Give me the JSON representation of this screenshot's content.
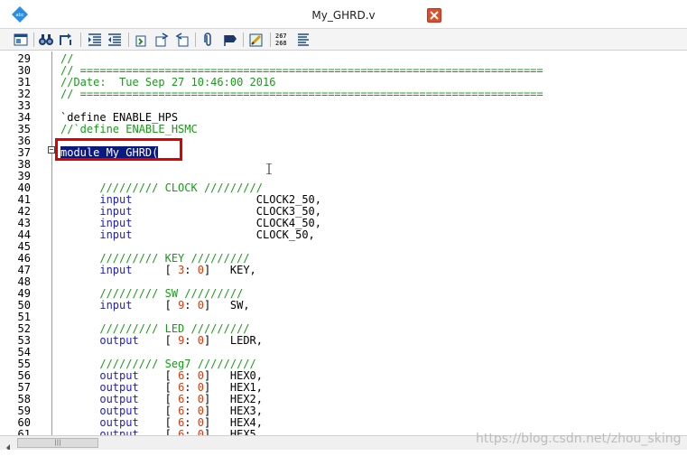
{
  "window": {
    "title": "My_GHRD.v",
    "app_icon_text": "abc"
  },
  "toolbar": {
    "line_count_top": "267",
    "line_count_bottom": "268"
  },
  "code_lines": [
    {
      "n": "29",
      "segments": [
        {
          "t": "//",
          "c": "green"
        }
      ]
    },
    {
      "n": "30",
      "segments": [
        {
          "t": "// =======================================================================",
          "c": "green"
        }
      ]
    },
    {
      "n": "31",
      "segments": [
        {
          "t": "//Date:  Tue Sep 27 10:46:00 2016",
          "c": "green"
        }
      ]
    },
    {
      "n": "32",
      "segments": [
        {
          "t": "// =======================================================================",
          "c": "green"
        }
      ]
    },
    {
      "n": "33",
      "segments": []
    },
    {
      "n": "34",
      "segments": [
        {
          "t": "`define ENABLE_HPS",
          "c": "black"
        }
      ]
    },
    {
      "n": "35",
      "segments": [
        {
          "t": "//`define ENABLE_HSMC",
          "c": "green"
        }
      ]
    },
    {
      "n": "36",
      "segments": []
    },
    {
      "n": "37",
      "segments": [
        {
          "t": "module My_GHRD(",
          "c": "sel"
        }
      ]
    },
    {
      "n": "38",
      "segments": []
    },
    {
      "n": "39",
      "segments": []
    },
    {
      "n": "40",
      "segments": [
        {
          "t": "      ///////// CLOCK /////////",
          "c": "green"
        }
      ]
    },
    {
      "n": "41",
      "segments": [
        {
          "t": "      input",
          "c": "blue"
        },
        {
          "t": "                   CLOCK2_50,",
          "c": "black"
        }
      ]
    },
    {
      "n": "42",
      "segments": [
        {
          "t": "      input",
          "c": "blue"
        },
        {
          "t": "                   CLOCK3_50,",
          "c": "black"
        }
      ]
    },
    {
      "n": "43",
      "segments": [
        {
          "t": "      input",
          "c": "blue"
        },
        {
          "t": "                   CLOCK4_50,",
          "c": "black"
        }
      ]
    },
    {
      "n": "44",
      "segments": [
        {
          "t": "      input",
          "c": "blue"
        },
        {
          "t": "                   CLOCK_50,",
          "c": "black"
        }
      ]
    },
    {
      "n": "45",
      "segments": []
    },
    {
      "n": "46",
      "segments": [
        {
          "t": "      ///////// KEY /////////",
          "c": "green"
        }
      ]
    },
    {
      "n": "47",
      "segments": [
        {
          "t": "      input",
          "c": "blue"
        },
        {
          "t": "     [ ",
          "c": "black"
        },
        {
          "t": "3",
          "c": "red"
        },
        {
          "t": ": ",
          "c": "black"
        },
        {
          "t": "0",
          "c": "red"
        },
        {
          "t": "]   KEY,",
          "c": "black"
        }
      ]
    },
    {
      "n": "48",
      "segments": []
    },
    {
      "n": "49",
      "segments": [
        {
          "t": "      ///////// SW /////////",
          "c": "green"
        }
      ]
    },
    {
      "n": "50",
      "segments": [
        {
          "t": "      input",
          "c": "blue"
        },
        {
          "t": "     [ ",
          "c": "black"
        },
        {
          "t": "9",
          "c": "red"
        },
        {
          "t": ": ",
          "c": "black"
        },
        {
          "t": "0",
          "c": "red"
        },
        {
          "t": "]   SW,",
          "c": "black"
        }
      ]
    },
    {
      "n": "51",
      "segments": []
    },
    {
      "n": "52",
      "segments": [
        {
          "t": "      ///////// LED /////////",
          "c": "green"
        }
      ]
    },
    {
      "n": "53",
      "segments": [
        {
          "t": "      output",
          "c": "blue"
        },
        {
          "t": "    [ ",
          "c": "black"
        },
        {
          "t": "9",
          "c": "red"
        },
        {
          "t": ": ",
          "c": "black"
        },
        {
          "t": "0",
          "c": "red"
        },
        {
          "t": "]   LEDR,",
          "c": "black"
        }
      ]
    },
    {
      "n": "54",
      "segments": []
    },
    {
      "n": "55",
      "segments": [
        {
          "t": "      ///////// Seg7 /////////",
          "c": "green"
        }
      ]
    },
    {
      "n": "56",
      "segments": [
        {
          "t": "      output",
          "c": "blue"
        },
        {
          "t": "    [ ",
          "c": "black"
        },
        {
          "t": "6",
          "c": "red"
        },
        {
          "t": ": ",
          "c": "black"
        },
        {
          "t": "0",
          "c": "red"
        },
        {
          "t": "]   HEX0,",
          "c": "black"
        }
      ]
    },
    {
      "n": "57",
      "segments": [
        {
          "t": "      output",
          "c": "blue"
        },
        {
          "t": "    [ ",
          "c": "black"
        },
        {
          "t": "6",
          "c": "red"
        },
        {
          "t": ": ",
          "c": "black"
        },
        {
          "t": "0",
          "c": "red"
        },
        {
          "t": "]   HEX1,",
          "c": "black"
        }
      ]
    },
    {
      "n": "58",
      "segments": [
        {
          "t": "      output",
          "c": "blue"
        },
        {
          "t": "    [ ",
          "c": "black"
        },
        {
          "t": "6",
          "c": "red"
        },
        {
          "t": ": ",
          "c": "black"
        },
        {
          "t": "0",
          "c": "red"
        },
        {
          "t": "]   HEX2,",
          "c": "black"
        }
      ]
    },
    {
      "n": "59",
      "segments": [
        {
          "t": "      output",
          "c": "blue"
        },
        {
          "t": "    [ ",
          "c": "black"
        },
        {
          "t": "6",
          "c": "red"
        },
        {
          "t": ": ",
          "c": "black"
        },
        {
          "t": "0",
          "c": "red"
        },
        {
          "t": "]   HEX3,",
          "c": "black"
        }
      ]
    },
    {
      "n": "60",
      "segments": [
        {
          "t": "      output",
          "c": "blue"
        },
        {
          "t": "    [ ",
          "c": "black"
        },
        {
          "t": "6",
          "c": "red"
        },
        {
          "t": ": ",
          "c": "black"
        },
        {
          "t": "0",
          "c": "red"
        },
        {
          "t": "]   HEX4,",
          "c": "black"
        }
      ]
    },
    {
      "n": "61",
      "segments": [
        {
          "t": "      output",
          "c": "blue"
        },
        {
          "t": "    [ ",
          "c": "black"
        },
        {
          "t": "6",
          "c": "red"
        },
        {
          "t": ": ",
          "c": "black"
        },
        {
          "t": "0",
          "c": "red"
        },
        {
          "t": "]   HEX5,",
          "c": "black"
        }
      ]
    }
  ],
  "watermark": "https://blog.csdn.net/zhou_sking"
}
